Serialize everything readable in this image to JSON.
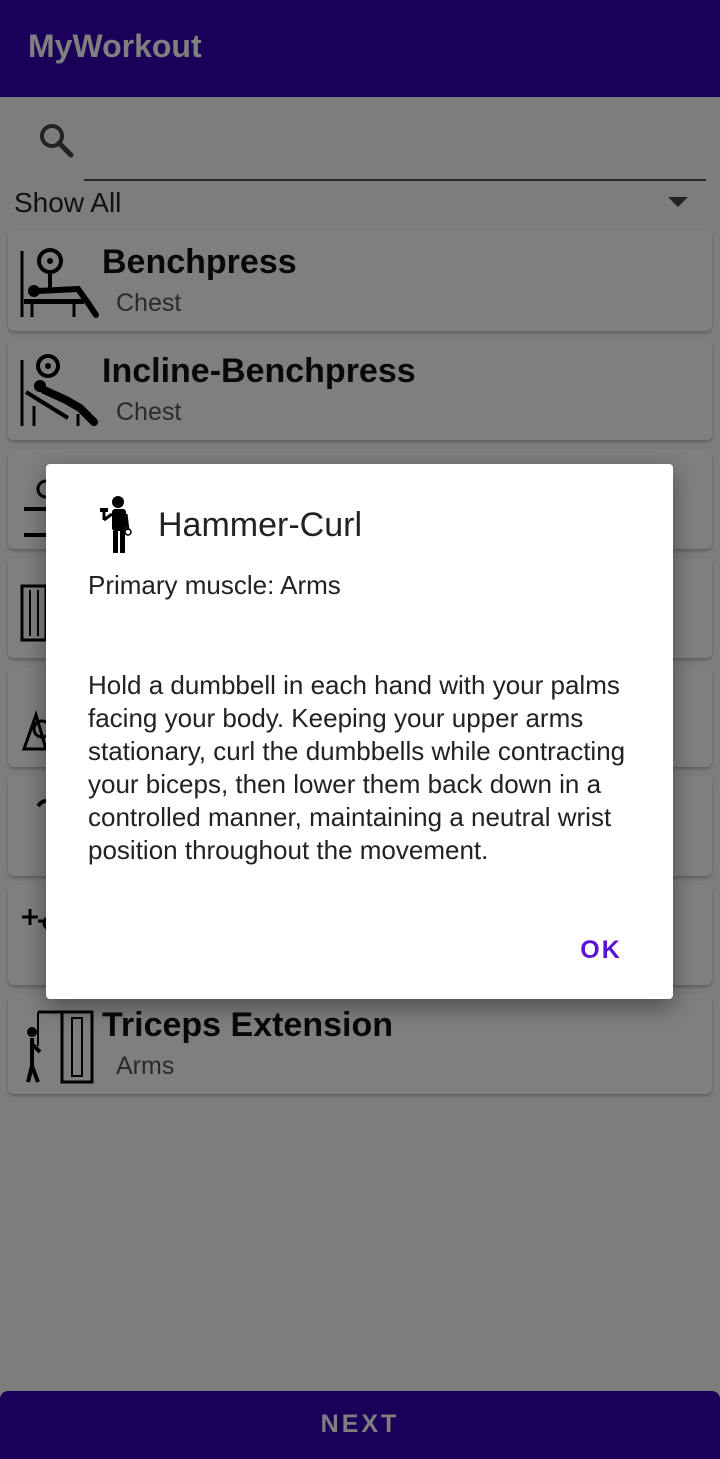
{
  "app": {
    "title": "MyWorkout"
  },
  "search": {
    "placeholder": "",
    "value": ""
  },
  "filter": {
    "selected": "Show All"
  },
  "exercises": [
    {
      "name": "Benchpress",
      "muscle": "Chest",
      "icon": "benchpress-icon"
    },
    {
      "name": "Incline-Benchpress",
      "muscle": "Chest",
      "icon": "incline-benchpress-icon"
    },
    {
      "name": "",
      "muscle": "",
      "icon": "exercise-icon"
    },
    {
      "name": "",
      "muscle": "",
      "icon": "exercise-icon"
    },
    {
      "name": "",
      "muscle": "",
      "icon": "exercise-icon"
    },
    {
      "name": "",
      "muscle": "",
      "icon": "exercise-icon"
    },
    {
      "name": "",
      "muscle": "",
      "icon": "exercise-icon"
    },
    {
      "name": "Triceps Extension",
      "muscle": "Arms",
      "icon": "triceps-extension-icon"
    }
  ],
  "next_button": {
    "label": "NEXT"
  },
  "dialog": {
    "title": "Hammer-Curl",
    "icon": "hammer-curl-icon",
    "primary_muscle": "Primary muscle: Arms",
    "description": "Hold a dumbbell in each hand with your palms facing your body. Keeping your upper arms stationary, curl the dumbbells while contracting your biceps, then lower them back down in a controlled manner, maintaining a neutral wrist position throughout the movement.",
    "ok_label": "OK"
  },
  "colors": {
    "primary": "#3700b3",
    "accent": "#5c12d6"
  }
}
